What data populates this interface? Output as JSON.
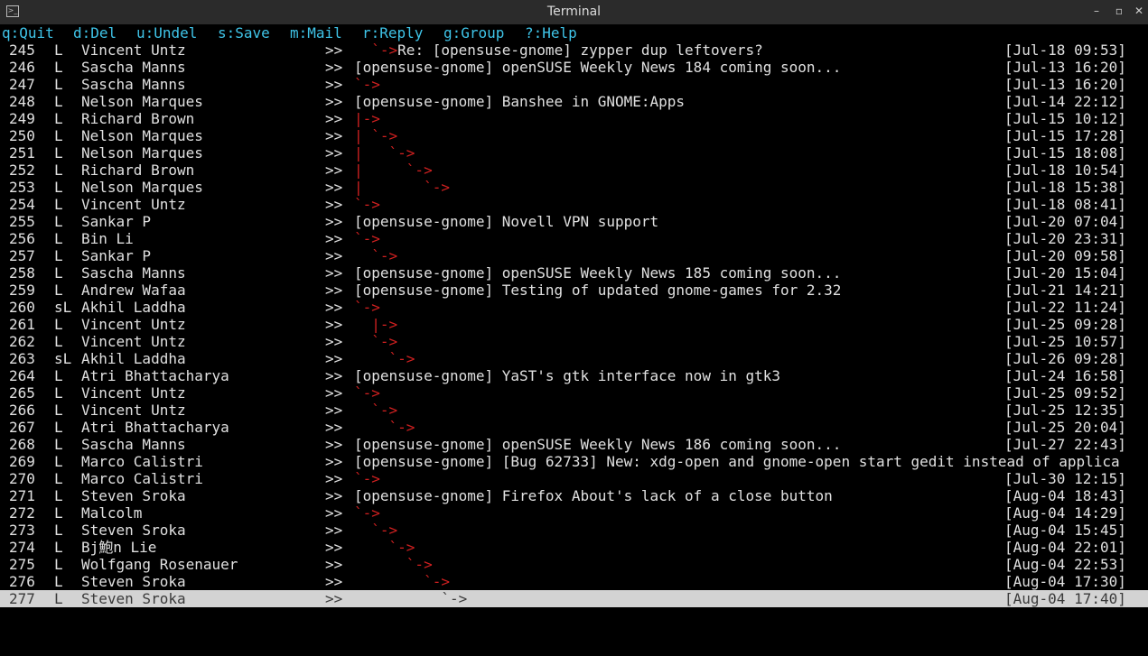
{
  "window": {
    "title": "Terminal"
  },
  "menu": [
    {
      "key": "q",
      "label": "q:Quit"
    },
    {
      "key": "d",
      "label": "d:Del"
    },
    {
      "key": "u",
      "label": "u:Undel"
    },
    {
      "key": "s",
      "label": "s:Save"
    },
    {
      "key": "m",
      "label": "m:Mail"
    },
    {
      "key": "r",
      "label": "r:Reply"
    },
    {
      "key": "g",
      "label": "g:Group"
    },
    {
      "key": "?",
      "label": "?:Help"
    }
  ],
  "messages": [
    {
      "num": "245",
      "flags": "L",
      "author": "Vincent Untz",
      "marker": ">>",
      "tree": "  `->",
      "subject": "Re: [opensuse-gnome] zypper dup leftovers?",
      "date": "[Jul-18 09:53]"
    },
    {
      "num": "246",
      "flags": "L",
      "author": "Sascha Manns",
      "marker": ">>",
      "tree": "",
      "subject": "[opensuse-gnome] openSUSE Weekly News 184 coming soon...",
      "date": "[Jul-13 16:20]"
    },
    {
      "num": "247",
      "flags": "L",
      "author": "Sascha Manns",
      "marker": ">>",
      "tree": "`->",
      "subject": "",
      "date": "[Jul-13 16:20]"
    },
    {
      "num": "248",
      "flags": "L",
      "author": "Nelson Marques",
      "marker": ">>",
      "tree": "",
      "subject": "[opensuse-gnome] Banshee in GNOME:Apps",
      "date": "[Jul-14 22:12]"
    },
    {
      "num": "249",
      "flags": "L",
      "author": "Richard Brown",
      "marker": ">>",
      "tree": "|->",
      "subject": "",
      "date": "[Jul-15 10:12]"
    },
    {
      "num": "250",
      "flags": "L",
      "author": "Nelson Marques",
      "marker": ">>",
      "tree": "| `->",
      "subject": "",
      "date": "[Jul-15 17:28]"
    },
    {
      "num": "251",
      "flags": "L",
      "author": "Nelson Marques",
      "marker": ">>",
      "tree": "|   `->",
      "subject": "",
      "date": "[Jul-15 18:08]"
    },
    {
      "num": "252",
      "flags": "L",
      "author": "Richard Brown",
      "marker": ">>",
      "tree": "|     `->",
      "subject": "",
      "date": "[Jul-18 10:54]"
    },
    {
      "num": "253",
      "flags": "L",
      "author": "Nelson Marques",
      "marker": ">>",
      "tree": "|       `->",
      "subject": "",
      "date": "[Jul-18 15:38]"
    },
    {
      "num": "254",
      "flags": "L",
      "author": "Vincent Untz",
      "marker": ">>",
      "tree": "`->",
      "subject": "",
      "date": "[Jul-18 08:41]"
    },
    {
      "num": "255",
      "flags": "L",
      "author": "Sankar P",
      "marker": ">>",
      "tree": "",
      "subject": "[opensuse-gnome] Novell VPN support",
      "date": "[Jul-20 07:04]"
    },
    {
      "num": "256",
      "flags": "L",
      "author": "Bin Li",
      "marker": ">>",
      "tree": "`->",
      "subject": "",
      "date": "[Jul-20 23:31]"
    },
    {
      "num": "257",
      "flags": "L",
      "author": "Sankar P",
      "marker": ">>",
      "tree": "  `->",
      "subject": "",
      "date": "[Jul-20 09:58]"
    },
    {
      "num": "258",
      "flags": "L",
      "author": "Sascha Manns",
      "marker": ">>",
      "tree": "",
      "subject": "[opensuse-gnome] openSUSE Weekly News 185 coming soon...",
      "date": "[Jul-20 15:04]"
    },
    {
      "num": "259",
      "flags": "L",
      "author": "Andrew Wafaa",
      "marker": ">>",
      "tree": "",
      "subject": "[opensuse-gnome] Testing of updated gnome-games for 2.32",
      "date": "[Jul-21 14:21]"
    },
    {
      "num": "260",
      "flags": "sL",
      "author": "Akhil Laddha",
      "marker": ">>",
      "tree": "`->",
      "subject": "",
      "date": "[Jul-22 11:24]"
    },
    {
      "num": "261",
      "flags": "L",
      "author": "Vincent Untz",
      "marker": ">>",
      "tree": "  |->",
      "subject": "",
      "date": "[Jul-25 09:28]"
    },
    {
      "num": "262",
      "flags": "L",
      "author": "Vincent Untz",
      "marker": ">>",
      "tree": "  `->",
      "subject": "",
      "date": "[Jul-25 10:57]"
    },
    {
      "num": "263",
      "flags": "sL",
      "author": "Akhil Laddha",
      "marker": ">>",
      "tree": "    `->",
      "subject": "",
      "date": "[Jul-26 09:28]"
    },
    {
      "num": "264",
      "flags": "L",
      "author": "Atri Bhattacharya",
      "marker": ">>",
      "tree": "",
      "subject": "[opensuse-gnome] YaST's gtk interface now in gtk3",
      "date": "[Jul-24 16:58]"
    },
    {
      "num": "265",
      "flags": "L",
      "author": "Vincent Untz",
      "marker": ">>",
      "tree": "`->",
      "subject": "",
      "date": "[Jul-25 09:52]"
    },
    {
      "num": "266",
      "flags": "L",
      "author": "Vincent Untz",
      "marker": ">>",
      "tree": "  `->",
      "subject": "",
      "date": "[Jul-25 12:35]"
    },
    {
      "num": "267",
      "flags": "L",
      "author": "Atri Bhattacharya",
      "marker": ">>",
      "tree": "    `->",
      "subject": "",
      "date": "[Jul-25 20:04]"
    },
    {
      "num": "268",
      "flags": "L",
      "author": "Sascha Manns",
      "marker": ">>",
      "tree": "",
      "subject": "[opensuse-gnome] openSUSE Weekly News 186 coming soon...",
      "date": "[Jul-27 22:43]"
    },
    {
      "num": "269",
      "flags": "L",
      "author": "Marco Calistri",
      "marker": ">>",
      "tree": "",
      "subject": "[opensuse-gnome] [Bug 62733] New: xdg-open and gnome-open start gedit instead of applica",
      "date": ""
    },
    {
      "num": "270",
      "flags": "L",
      "author": "Marco Calistri",
      "marker": ">>",
      "tree": "`->",
      "subject": "",
      "date": "[Jul-30 12:15]"
    },
    {
      "num": "271",
      "flags": "L",
      "author": "Steven Sroka",
      "marker": ">>",
      "tree": "",
      "subject": "[opensuse-gnome] Firefox About's lack of a close button",
      "date": "[Aug-04 18:43]"
    },
    {
      "num": "272",
      "flags": "L",
      "author": "Malcolm",
      "marker": ">>",
      "tree": "`->",
      "subject": "",
      "date": "[Aug-04 14:29]"
    },
    {
      "num": "273",
      "flags": "L",
      "author": "Steven Sroka",
      "marker": ">>",
      "tree": "  `->",
      "subject": "",
      "date": "[Aug-04 15:45]"
    },
    {
      "num": "274",
      "flags": "L",
      "author": "Bj鮑n Lie",
      "marker": ">>",
      "tree": "    `->",
      "subject": "",
      "date": "[Aug-04 22:01]"
    },
    {
      "num": "275",
      "flags": "L",
      "author": "Wolfgang Rosenauer",
      "marker": ">>",
      "tree": "      `->",
      "subject": "",
      "date": "[Aug-04 22:53]"
    },
    {
      "num": "276",
      "flags": "L",
      "author": "Steven Sroka",
      "marker": ">>",
      "tree": "        `->",
      "subject": "",
      "date": "[Aug-04 17:30]"
    },
    {
      "num": "277",
      "flags": "L",
      "author": "Steven Sroka",
      "marker": ">>",
      "tree": "          `->",
      "subject": "",
      "date": "[Aug-04 17:40]",
      "current": true
    }
  ]
}
